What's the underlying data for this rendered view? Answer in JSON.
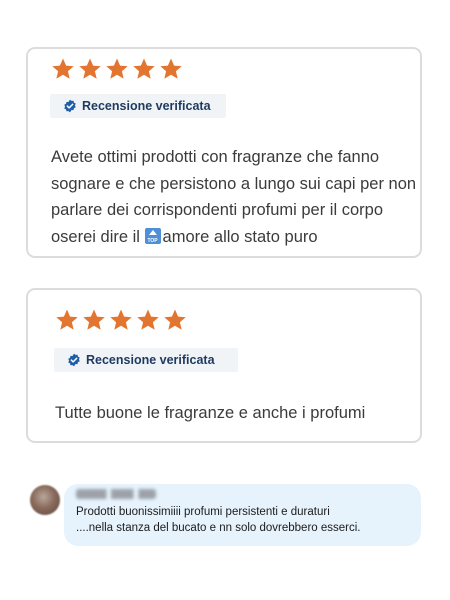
{
  "reviews": [
    {
      "rating": 5,
      "badge_label": "Recensione verificata",
      "text_before_emoji": "Avete ottimi prodotti con fragranze che fanno sognare e che persistono a lungo sui capi per non parlare dei corrispondenti profumi per il corpo oserei dire il ",
      "emoji": "top-arrow-emoji",
      "text_after_emoji": "amore allo stato puro"
    },
    {
      "rating": 5,
      "badge_label": "Recensione verificata",
      "text": "Tutte buone le fragranze e anche i profumi"
    }
  ],
  "comment": {
    "line1": "Prodotti buonissimiiii profumi persistenti e duraturi",
    "line2": "....nella stanza del bucato e nn solo dovrebbero esserci."
  },
  "colors": {
    "star": "#e2752f",
    "badge_text": "#1f3a5f",
    "verified_icon": "#1f5fa8",
    "comment_bubble": "#e6f2fc"
  }
}
